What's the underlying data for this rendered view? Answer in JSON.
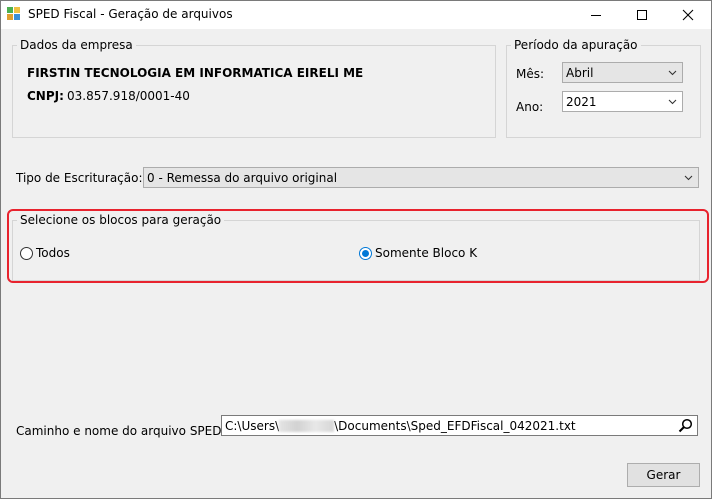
{
  "window": {
    "title": "SPED Fiscal - Geração de arquivos"
  },
  "empresa": {
    "legend": "Dados da empresa",
    "name": "FIRSTIN TECNOLOGIA EM INFORMATICA EIRELI ME",
    "cnpj_label": "CNPJ:",
    "cnpj_value": "03.857.918/0001-40"
  },
  "periodo": {
    "legend": "Período da apuração",
    "mes_label": "Mês:",
    "mes_value": "Abril",
    "ano_label": "Ano:",
    "ano_value": "2021"
  },
  "escrituracao": {
    "label": "Tipo de Escrituração:",
    "value": "0 - Remessa do arquivo original"
  },
  "blocos": {
    "legend": "Selecione os blocos para geração",
    "options": [
      {
        "label": "Todos",
        "checked": false
      },
      {
        "label": "Somente Bloco K",
        "checked": true
      }
    ]
  },
  "arquivo": {
    "label": "Caminho e nome do arquivo SPED:",
    "path_prefix": "C:\\Users\\",
    "path_suffix": "\\Documents\\Sped_EFDFiscal_042021.txt"
  },
  "actions": {
    "gerar_label": "Gerar"
  },
  "colors": {
    "highlight": "#e8232e",
    "radio_accent": "#0078d7"
  }
}
